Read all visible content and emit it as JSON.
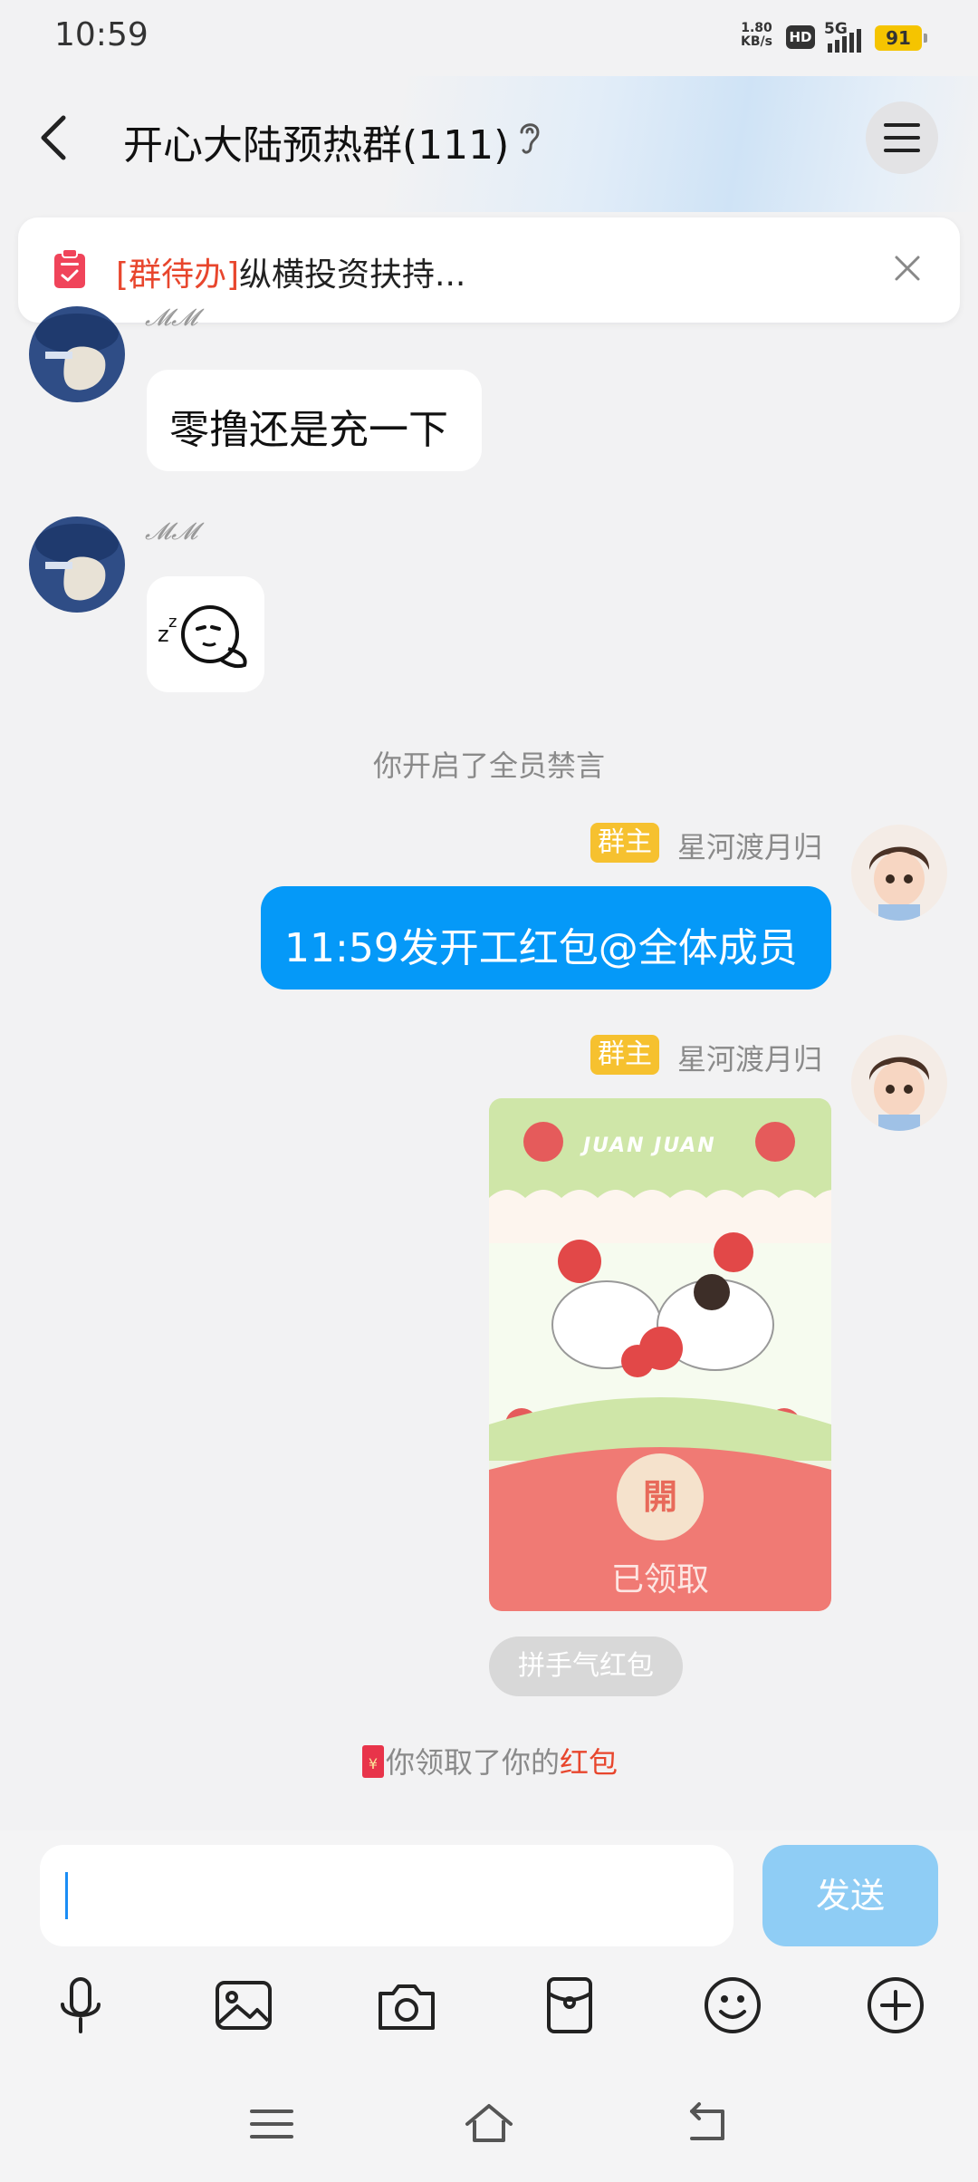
{
  "status_bar": {
    "time": "10:59",
    "speed_value": "1.80",
    "speed_unit": "KB/s",
    "hd": "HD",
    "network": "5G",
    "battery": "91"
  },
  "header": {
    "title": "开心大陆预热群(111)",
    "back_icon": "back-arrow-icon",
    "ear_icon": "ear-icon",
    "menu_icon": "menu-icon"
  },
  "todo": {
    "tag": "[群待办]",
    "text": "纵横投资扶持..."
  },
  "messages": {
    "msg1": {
      "nickname": "𝓜𝓜",
      "text": "零撸还是充一下"
    },
    "msg2": {
      "nickname": "𝓜𝓜",
      "sticker": "sleeping-face-sticker"
    },
    "system1": "你开启了全员禁言",
    "msg3": {
      "badge": "群主",
      "sender": "星河渡月归",
      "text": "11:59发开工红包@全体成员"
    },
    "msg4": {
      "badge": "群主",
      "sender": "星河渡月归",
      "envelope_banner": "JUAN JUAN",
      "open_label": "開",
      "status": "已领取",
      "type_label": "拼手气红包"
    },
    "system2": {
      "prefix": "你领取了你的",
      "link": "红包"
    }
  },
  "input": {
    "placeholder": "",
    "send_label": "发送"
  },
  "toolbar": {
    "icons": [
      "microphone-icon",
      "image-icon",
      "camera-icon",
      "red-packet-icon",
      "emoji-icon",
      "plus-icon"
    ]
  },
  "navbar": {
    "icons": [
      "recent-apps-icon",
      "home-icon",
      "back-icon"
    ]
  },
  "colors": {
    "accent": "#0599f8",
    "badge": "#f6c12f",
    "red": "#e8462d",
    "send_disabled": "#8fcdf5"
  }
}
